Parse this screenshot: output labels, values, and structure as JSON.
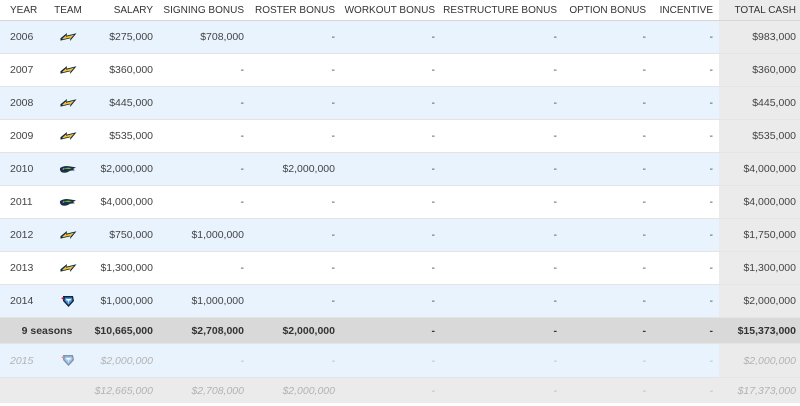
{
  "headers": {
    "year": "YEAR",
    "team": "TEAM",
    "salary": "SALARY",
    "signing": "SIGNING BONUS",
    "roster": "ROSTER BONUS",
    "workout": "WORKOUT BONUS",
    "restructure": "RESTRUCTURE BONUS",
    "option": "OPTION BONUS",
    "incentive": "INCENTIVE",
    "total": "TOTAL CASH"
  },
  "rows": [
    {
      "year": "2006",
      "team_icon": "chargers-bolt-icon",
      "salary": "$275,000",
      "signing": "$708,000",
      "roster": "-",
      "workout": "-",
      "restructure": "-",
      "option": "-",
      "incentive": "-",
      "total": "$983,000"
    },
    {
      "year": "2007",
      "team_icon": "chargers-bolt-icon",
      "salary": "$360,000",
      "signing": "-",
      "roster": "-",
      "workout": "-",
      "restructure": "-",
      "option": "-",
      "incentive": "-",
      "total": "$360,000"
    },
    {
      "year": "2008",
      "team_icon": "chargers-bolt-icon",
      "salary": "$445,000",
      "signing": "-",
      "roster": "-",
      "workout": "-",
      "restructure": "-",
      "option": "-",
      "incentive": "-",
      "total": "$445,000"
    },
    {
      "year": "2009",
      "team_icon": "chargers-bolt-icon",
      "salary": "$535,000",
      "signing": "-",
      "roster": "-",
      "workout": "-",
      "restructure": "-",
      "option": "-",
      "incentive": "-",
      "total": "$535,000"
    },
    {
      "year": "2010",
      "team_icon": "seahawks-icon",
      "salary": "$2,000,000",
      "signing": "-",
      "roster": "$2,000,000",
      "workout": "-",
      "restructure": "-",
      "option": "-",
      "incentive": "-",
      "total": "$4,000,000"
    },
    {
      "year": "2011",
      "team_icon": "seahawks-icon",
      "salary": "$4,000,000",
      "signing": "-",
      "roster": "-",
      "workout": "-",
      "restructure": "-",
      "option": "-",
      "incentive": "-",
      "total": "$4,000,000"
    },
    {
      "year": "2012",
      "team_icon": "chargers-bolt-icon",
      "salary": "$750,000",
      "signing": "$1,000,000",
      "roster": "-",
      "workout": "-",
      "restructure": "-",
      "option": "-",
      "incentive": "-",
      "total": "$1,750,000"
    },
    {
      "year": "2013",
      "team_icon": "chargers-bolt-icon",
      "salary": "$1,300,000",
      "signing": "-",
      "roster": "-",
      "workout": "-",
      "restructure": "-",
      "option": "-",
      "incentive": "-",
      "total": "$1,300,000"
    },
    {
      "year": "2014",
      "team_icon": "titans-icon",
      "salary": "$1,000,000",
      "signing": "$1,000,000",
      "roster": "-",
      "workout": "-",
      "restructure": "-",
      "option": "-",
      "incentive": "-",
      "total": "$2,000,000"
    }
  ],
  "totals": {
    "label": "9 seasons",
    "salary": "$10,665,000",
    "signing": "$2,708,000",
    "roster": "$2,000,000",
    "workout": "-",
    "restructure": "-",
    "option": "-",
    "incentive": "-",
    "total": "$15,373,000"
  },
  "future": {
    "year": "2015",
    "team_icon": "titans-icon",
    "salary": "$2,000,000",
    "signing": "-",
    "roster": "-",
    "workout": "-",
    "restructure": "-",
    "option": "-",
    "incentive": "-",
    "total": "$2,000,000"
  },
  "grand_totals": {
    "salary": "$12,665,000",
    "signing": "$2,708,000",
    "roster": "$2,000,000",
    "workout": "-",
    "restructure": "-",
    "option": "-",
    "incentive": "-",
    "total": "$17,373,000"
  },
  "colors": {
    "row_highlight": "#e8f3fd",
    "total_row": "#d9d9d9",
    "total_column": "#ebebeb",
    "chargers_navy": "#0a2342",
    "chargers_gold": "#f2c12e",
    "seahawks_navy": "#1b2f4b",
    "titans_navy": "#0c2340",
    "titans_blue": "#4b92db"
  }
}
